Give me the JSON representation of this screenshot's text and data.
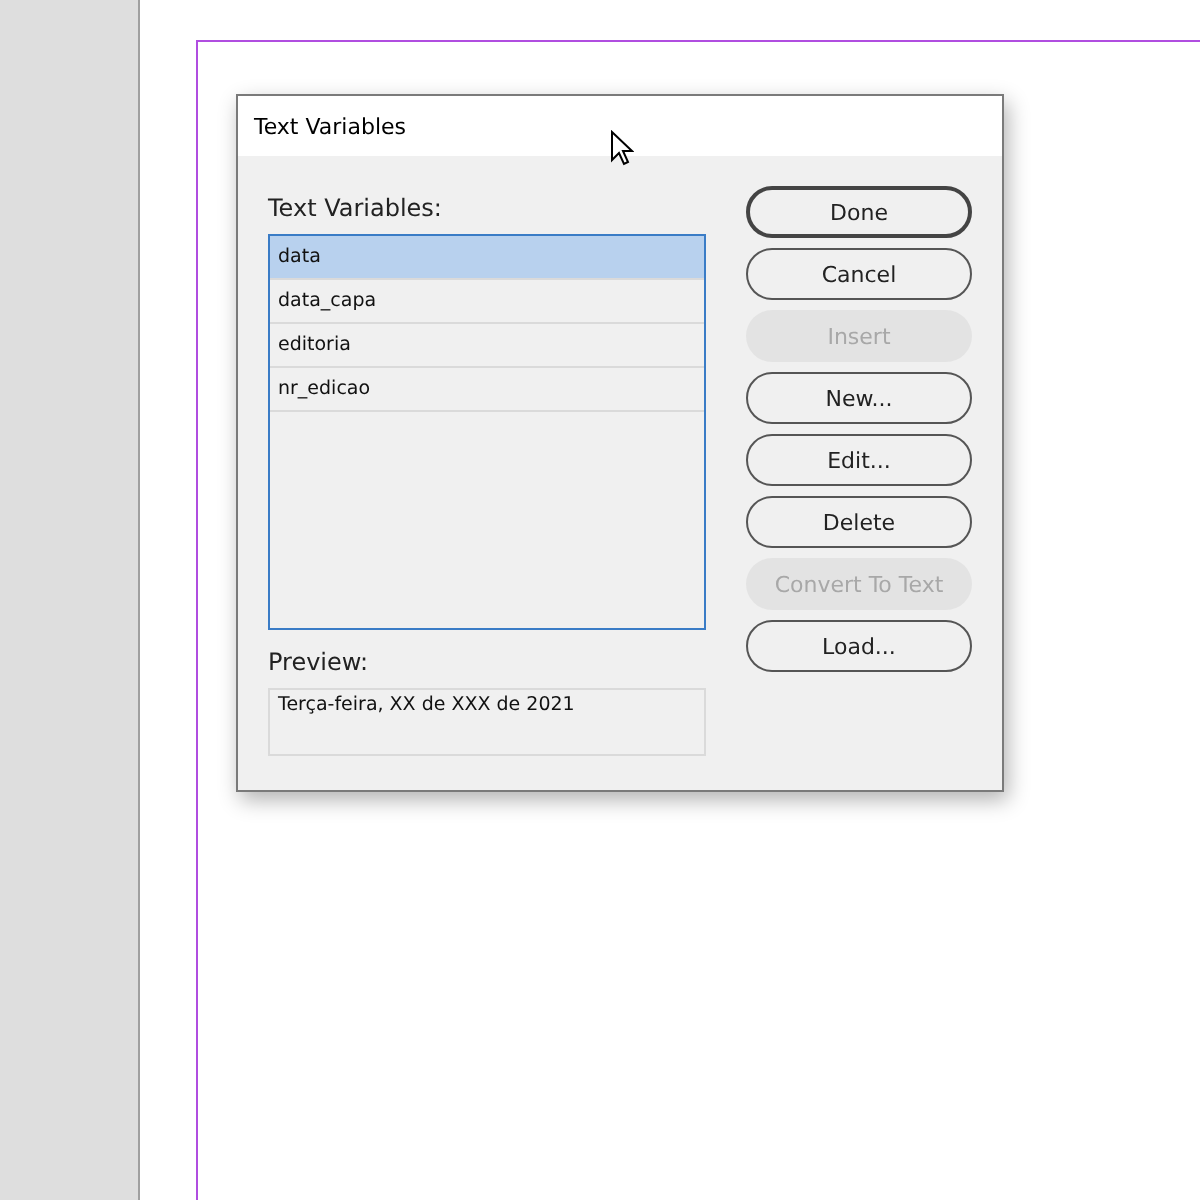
{
  "dialog": {
    "title": "Text Variables",
    "list_label": "Text Variables:",
    "variables": [
      {
        "name": "data",
        "selected": true
      },
      {
        "name": "data_capa",
        "selected": false
      },
      {
        "name": "editoria",
        "selected": false
      },
      {
        "name": "nr_edicao",
        "selected": false
      }
    ],
    "preview_label": "Preview:",
    "preview": "Terça-feira, XX de XXX de 2021",
    "buttons": [
      {
        "label": "Done",
        "default": true,
        "disabled": false
      },
      {
        "label": "Cancel",
        "default": false,
        "disabled": false
      },
      {
        "label": "Insert",
        "default": false,
        "disabled": true
      },
      {
        "label": "New...",
        "default": false,
        "disabled": false
      },
      {
        "label": "Edit...",
        "default": false,
        "disabled": false
      },
      {
        "label": "Delete",
        "default": false,
        "disabled": false
      },
      {
        "label": "Convert To Text",
        "default": false,
        "disabled": true
      },
      {
        "label": "Load...",
        "default": false,
        "disabled": false
      }
    ]
  }
}
